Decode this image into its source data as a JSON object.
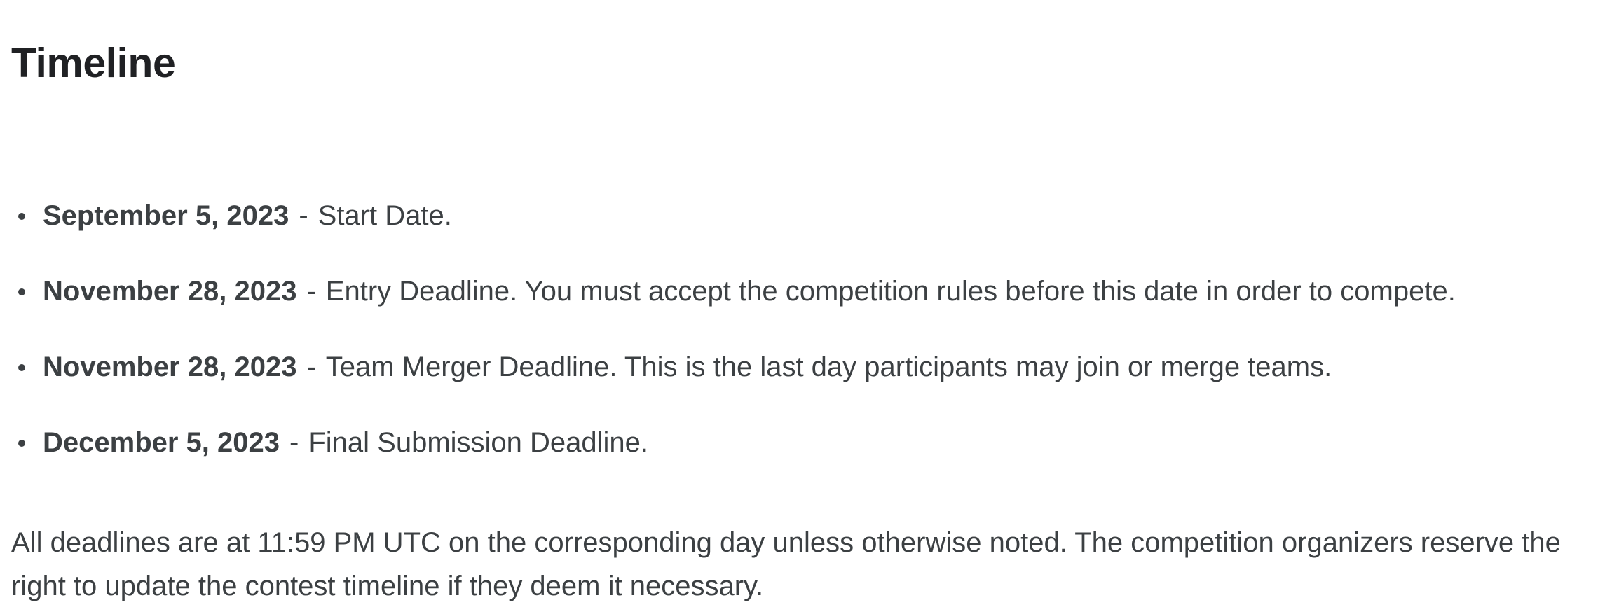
{
  "heading": "Timeline",
  "timeline": [
    {
      "date": "September 5, 2023",
      "separator": "-",
      "text": "Start Date."
    },
    {
      "date": "November 28, 2023",
      "separator": "-",
      "text": "Entry Deadline. You must accept the competition rules before this date in order to compete."
    },
    {
      "date": "November 28, 2023",
      "separator": "-",
      "text": "Team Merger Deadline. This is the last day participants may join or merge teams."
    },
    {
      "date": "December 5, 2023",
      "separator": "-",
      "text": "Final Submission Deadline."
    }
  ],
  "note": "All deadlines are at 11:59 PM UTC on the corresponding day unless otherwise noted. The competition organizers reserve the right to update the contest timeline if they deem it necessary."
}
